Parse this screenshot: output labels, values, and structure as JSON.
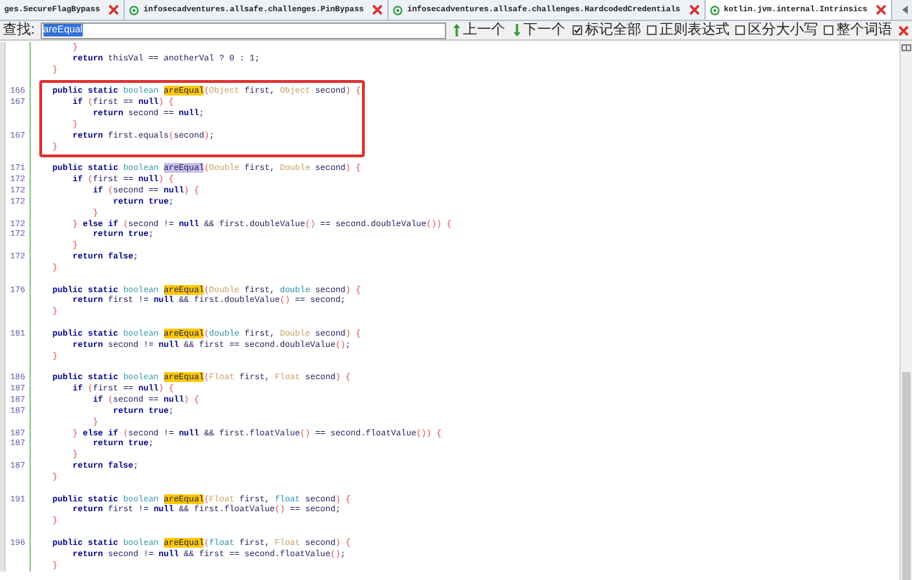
{
  "tabs": [
    {
      "label": "ges.SecureFlagBypass",
      "icon": false,
      "selected": false
    },
    {
      "label": "infosecadventures.allsafe.challenges.PinBypass",
      "icon": true,
      "selected": false
    },
    {
      "label": "infosecadventures.allsafe.challenges.HardcodedCredentials",
      "icon": true,
      "selected": false
    },
    {
      "label": "kotlin.jvm.internal.Intrinsics",
      "icon": true,
      "selected": true
    }
  ],
  "find_bar": {
    "label": "查找:",
    "value": "areEqual",
    "value_selected": true,
    "nav_buttons": [
      {
        "label": "上一个"
      },
      {
        "label": "下一个"
      }
    ],
    "options": [
      {
        "label": "标记全部",
        "checked": true
      },
      {
        "label": "正则表达式",
        "checked": false
      },
      {
        "label": "区分大小写",
        "checked": false
      },
      {
        "label": "整个词语",
        "checked": false
      }
    ]
  },
  "code_blocks": [
    {
      "framed": false,
      "lines": [
        {
          "tokens": [
            {
              "kind": "symbol",
              "text": "        }"
            }
          ]
        },
        {
          "tokens": [
            {
              "kind": "keyword",
              "text": "        return"
            },
            {
              "kind": "plain",
              "text": " thisVal == anotherVal ? 0 : 1;"
            }
          ]
        },
        {
          "tokens": [
            {
              "kind": "symbol",
              "text": "    }"
            }
          ]
        }
      ]
    },
    {
      "framed": true,
      "lines": [
        {
          "num": "166",
          "tokens": [
            {
              "kind": "keyword",
              "text": "    public static"
            },
            {
              "kind": "boolean",
              "text": " boolean "
            },
            {
              "kind": "match",
              "text": "areEqual"
            },
            {
              "kind": "symbol",
              "text": "("
            },
            {
              "kind": "boxed",
              "text": "Object"
            },
            {
              "kind": "plain",
              "text": " first, "
            },
            {
              "kind": "boxed",
              "text": "Object"
            },
            {
              "kind": "plain",
              "text": " second"
            },
            {
              "kind": "symbol",
              "text": ") {"
            }
          ]
        },
        {
          "num": "167",
          "tokens": [
            {
              "kind": "keyword",
              "text": "        if"
            },
            {
              "kind": "symbol",
              "text": " ("
            },
            {
              "kind": "plain",
              "text": "first == "
            },
            {
              "kind": "keyword",
              "text": "null"
            },
            {
              "kind": "symbol",
              "text": ") {"
            }
          ]
        },
        {
          "tokens": [
            {
              "kind": "keyword",
              "text": "            return"
            },
            {
              "kind": "plain",
              "text": " second == "
            },
            {
              "kind": "keyword",
              "text": "null"
            },
            {
              "kind": "plain",
              "text": ";"
            }
          ]
        },
        {
          "tokens": [
            {
              "kind": "symbol",
              "text": "        }"
            }
          ]
        },
        {
          "num": "167",
          "tokens": [
            {
              "kind": "keyword",
              "text": "        return"
            },
            {
              "kind": "plain",
              "text": " first.equals"
            },
            {
              "kind": "symbol",
              "text": "("
            },
            {
              "kind": "plain",
              "text": "second"
            },
            {
              "kind": "symbol",
              "text": ")"
            },
            {
              "kind": "plain",
              "text": ";"
            }
          ]
        },
        {
          "tokens": [
            {
              "kind": "symbol",
              "text": "    }"
            }
          ]
        }
      ]
    },
    {
      "framed": false,
      "lines": [
        {
          "num": "171",
          "tokens": [
            {
              "kind": "keyword",
              "text": "    public static"
            },
            {
              "kind": "boolean",
              "text": " boolean "
            },
            {
              "kind": "current",
              "text": "areEqual"
            },
            {
              "kind": "symbol",
              "text": "("
            },
            {
              "kind": "boxed",
              "text": "Double"
            },
            {
              "kind": "plain",
              "text": " first, "
            },
            {
              "kind": "boxed",
              "text": "Double"
            },
            {
              "kind": "plain",
              "text": " second"
            },
            {
              "kind": "symbol",
              "text": ") {"
            }
          ]
        },
        {
          "num": "172",
          "tokens": [
            {
              "kind": "keyword",
              "text": "        if"
            },
            {
              "kind": "symbol",
              "text": " ("
            },
            {
              "kind": "plain",
              "text": "first == "
            },
            {
              "kind": "keyword",
              "text": "null"
            },
            {
              "kind": "symbol",
              "text": ") {"
            }
          ]
        },
        {
          "num": "172",
          "tokens": [
            {
              "kind": "keyword",
              "text": "            if"
            },
            {
              "kind": "symbol",
              "text": " ("
            },
            {
              "kind": "plain",
              "text": "second == "
            },
            {
              "kind": "keyword",
              "text": "null"
            },
            {
              "kind": "symbol",
              "text": ") {"
            }
          ]
        },
        {
          "num": "172",
          "tokens": [
            {
              "kind": "keyword",
              "text": "                return true"
            },
            {
              "kind": "plain",
              "text": ";"
            }
          ]
        },
        {
          "tokens": [
            {
              "kind": "symbol",
              "text": "            }"
            }
          ]
        },
        {
          "num": "172",
          "tokens": [
            {
              "kind": "symbol",
              "text": "        }"
            },
            {
              "kind": "keyword",
              "text": " else if"
            },
            {
              "kind": "symbol",
              "text": " ("
            },
            {
              "kind": "plain",
              "text": "second != "
            },
            {
              "kind": "keyword",
              "text": "null"
            },
            {
              "kind": "plain",
              "text": " && first.doubleValue"
            },
            {
              "kind": "symbol",
              "text": "()"
            },
            {
              "kind": "plain",
              "text": " == second.doubleValue"
            },
            {
              "kind": "symbol",
              "text": "()) {"
            }
          ]
        },
        {
          "num": "172",
          "tokens": [
            {
              "kind": "keyword",
              "text": "            return true"
            },
            {
              "kind": "plain",
              "text": ";"
            }
          ]
        },
        {
          "tokens": [
            {
              "kind": "symbol",
              "text": "        }"
            }
          ]
        },
        {
          "num": "172",
          "tokens": [
            {
              "kind": "keyword",
              "text": "        return false"
            },
            {
              "kind": "plain",
              "text": ";"
            }
          ]
        },
        {
          "tokens": [
            {
              "kind": "symbol",
              "text": "    }"
            }
          ]
        }
      ]
    },
    {
      "framed": false,
      "lines": [
        {
          "num": "176",
          "tokens": [
            {
              "kind": "keyword",
              "text": "    public static"
            },
            {
              "kind": "boolean",
              "text": " boolean "
            },
            {
              "kind": "match",
              "text": "areEqual"
            },
            {
              "kind": "symbol",
              "text": "("
            },
            {
              "kind": "boxed",
              "text": "Double"
            },
            {
              "kind": "plain",
              "text": " first, "
            },
            {
              "kind": "primitive",
              "text": "double"
            },
            {
              "kind": "plain",
              "text": " second"
            },
            {
              "kind": "symbol",
              "text": ") {"
            }
          ]
        },
        {
          "tokens": [
            {
              "kind": "keyword",
              "text": "        return"
            },
            {
              "kind": "plain",
              "text": " first != "
            },
            {
              "kind": "keyword",
              "text": "null"
            },
            {
              "kind": "plain",
              "text": " && first.doubleValue"
            },
            {
              "kind": "symbol",
              "text": "()"
            },
            {
              "kind": "plain",
              "text": " == second;"
            }
          ]
        },
        {
          "tokens": [
            {
              "kind": "symbol",
              "text": "    }"
            }
          ]
        }
      ]
    },
    {
      "framed": false,
      "lines": [
        {
          "num": "181",
          "tokens": [
            {
              "kind": "keyword",
              "text": "    public static"
            },
            {
              "kind": "boolean",
              "text": " boolean "
            },
            {
              "kind": "match",
              "text": "areEqual"
            },
            {
              "kind": "symbol",
              "text": "("
            },
            {
              "kind": "primitive",
              "text": "double"
            },
            {
              "kind": "plain",
              "text": " first, "
            },
            {
              "kind": "boxed",
              "text": "Double"
            },
            {
              "kind": "plain",
              "text": " second"
            },
            {
              "kind": "symbol",
              "text": ") {"
            }
          ]
        },
        {
          "tokens": [
            {
              "kind": "keyword",
              "text": "        return"
            },
            {
              "kind": "plain",
              "text": " second != "
            },
            {
              "kind": "keyword",
              "text": "null"
            },
            {
              "kind": "plain",
              "text": " && first == second.doubleValue"
            },
            {
              "kind": "symbol",
              "text": "()"
            },
            {
              "kind": "plain",
              "text": ";"
            }
          ]
        },
        {
          "tokens": [
            {
              "kind": "symbol",
              "text": "    }"
            }
          ]
        }
      ]
    },
    {
      "framed": false,
      "lines": [
        {
          "num": "186",
          "tokens": [
            {
              "kind": "keyword",
              "text": "    public static"
            },
            {
              "kind": "boolean",
              "text": " boolean "
            },
            {
              "kind": "match",
              "text": "areEqual"
            },
            {
              "kind": "symbol",
              "text": "("
            },
            {
              "kind": "boxed",
              "text": "Float"
            },
            {
              "kind": "plain",
              "text": " first, "
            },
            {
              "kind": "boxed",
              "text": "Float"
            },
            {
              "kind": "plain",
              "text": " second"
            },
            {
              "kind": "symbol",
              "text": ") {"
            }
          ]
        },
        {
          "num": "187",
          "tokens": [
            {
              "kind": "keyword",
              "text": "        if"
            },
            {
              "kind": "symbol",
              "text": " ("
            },
            {
              "kind": "plain",
              "text": "first == "
            },
            {
              "kind": "keyword",
              "text": "null"
            },
            {
              "kind": "symbol",
              "text": ") {"
            }
          ]
        },
        {
          "num": "187",
          "tokens": [
            {
              "kind": "keyword",
              "text": "            if"
            },
            {
              "kind": "symbol",
              "text": " ("
            },
            {
              "kind": "plain",
              "text": "second == "
            },
            {
              "kind": "keyword",
              "text": "null"
            },
            {
              "kind": "symbol",
              "text": ") {"
            }
          ]
        },
        {
          "num": "187",
          "tokens": [
            {
              "kind": "keyword",
              "text": "                return true"
            },
            {
              "kind": "plain",
              "text": ";"
            }
          ]
        },
        {
          "tokens": [
            {
              "kind": "symbol",
              "text": "            }"
            }
          ]
        },
        {
          "num": "187",
          "tokens": [
            {
              "kind": "symbol",
              "text": "        }"
            },
            {
              "kind": "keyword",
              "text": " else if"
            },
            {
              "kind": "symbol",
              "text": " ("
            },
            {
              "kind": "plain",
              "text": "second != "
            },
            {
              "kind": "keyword",
              "text": "null"
            },
            {
              "kind": "plain",
              "text": " && first.floatValue"
            },
            {
              "kind": "symbol",
              "text": "()"
            },
            {
              "kind": "plain",
              "text": " == second.floatValue"
            },
            {
              "kind": "symbol",
              "text": "()) {"
            }
          ]
        },
        {
          "num": "187",
          "tokens": [
            {
              "kind": "keyword",
              "text": "            return true"
            },
            {
              "kind": "plain",
              "text": ";"
            }
          ]
        },
        {
          "tokens": [
            {
              "kind": "symbol",
              "text": "        }"
            }
          ]
        },
        {
          "num": "187",
          "tokens": [
            {
              "kind": "keyword",
              "text": "        return false"
            },
            {
              "kind": "plain",
              "text": ";"
            }
          ]
        },
        {
          "tokens": [
            {
              "kind": "symbol",
              "text": "    }"
            }
          ]
        }
      ]
    },
    {
      "framed": false,
      "lines": [
        {
          "num": "191",
          "tokens": [
            {
              "kind": "keyword",
              "text": "    public static"
            },
            {
              "kind": "boolean",
              "text": " boolean "
            },
            {
              "kind": "match",
              "text": "areEqual"
            },
            {
              "kind": "symbol",
              "text": "("
            },
            {
              "kind": "boxed",
              "text": "Float"
            },
            {
              "kind": "plain",
              "text": " first, "
            },
            {
              "kind": "primitive",
              "text": "float"
            },
            {
              "kind": "plain",
              "text": " second"
            },
            {
              "kind": "symbol",
              "text": ") {"
            }
          ]
        },
        {
          "tokens": [
            {
              "kind": "keyword",
              "text": "        return"
            },
            {
              "kind": "plain",
              "text": " first != "
            },
            {
              "kind": "keyword",
              "text": "null"
            },
            {
              "kind": "plain",
              "text": " && first.floatValue"
            },
            {
              "kind": "symbol",
              "text": "()"
            },
            {
              "kind": "plain",
              "text": " == second;"
            }
          ]
        },
        {
          "tokens": [
            {
              "kind": "symbol",
              "text": "    }"
            }
          ]
        }
      ]
    },
    {
      "framed": false,
      "lines": [
        {
          "num": "196",
          "tokens": [
            {
              "kind": "keyword",
              "text": "    public static"
            },
            {
              "kind": "boolean",
              "text": " boolean "
            },
            {
              "kind": "match",
              "text": "areEqual"
            },
            {
              "kind": "symbol",
              "text": "("
            },
            {
              "kind": "primitive",
              "text": "float"
            },
            {
              "kind": "plain",
              "text": " first, "
            },
            {
              "kind": "boxed",
              "text": "Float"
            },
            {
              "kind": "plain",
              "text": " second"
            },
            {
              "kind": "symbol",
              "text": ") {"
            }
          ]
        },
        {
          "tokens": [
            {
              "kind": "keyword",
              "text": "        return"
            },
            {
              "kind": "plain",
              "text": " second != "
            },
            {
              "kind": "keyword",
              "text": "null"
            },
            {
              "kind": "plain",
              "text": " && first == second.floatValue"
            },
            {
              "kind": "symbol",
              "text": "()"
            },
            {
              "kind": "plain",
              "text": ";"
            }
          ]
        },
        {
          "tokens": [
            {
              "kind": "symbol",
              "text": "    }"
            }
          ]
        }
      ]
    }
  ]
}
